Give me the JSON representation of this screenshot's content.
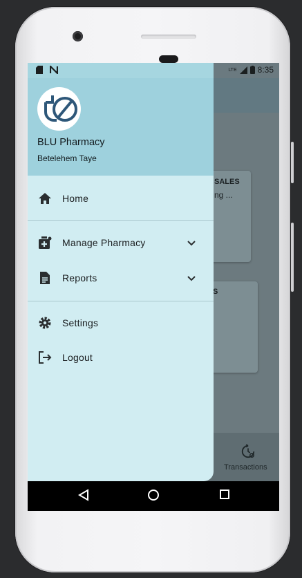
{
  "status_bar": {
    "time": "8:35"
  },
  "drawer": {
    "title": "BLU Pharmacy",
    "user": "Betelehem Taye",
    "items": [
      {
        "label": "Home",
        "icon": "home-icon"
      },
      {
        "label": "Manage Pharmacy",
        "icon": "medical-bag-icon",
        "expandable": true
      },
      {
        "label": "Reports",
        "icon": "document-icon",
        "expandable": true
      },
      {
        "label": "Settings",
        "icon": "gear-icon"
      },
      {
        "label": "Logout",
        "icon": "logout-icon"
      }
    ]
  },
  "background": {
    "card1_title": "SALES",
    "card1_sub": "ng ...",
    "card2_title": "S",
    "bottom_nav_label": "Transactions"
  },
  "colors": {
    "drawer_header": "#9ed1dd",
    "drawer_body": "#d1edf2",
    "scrim": "#6b7a80"
  }
}
